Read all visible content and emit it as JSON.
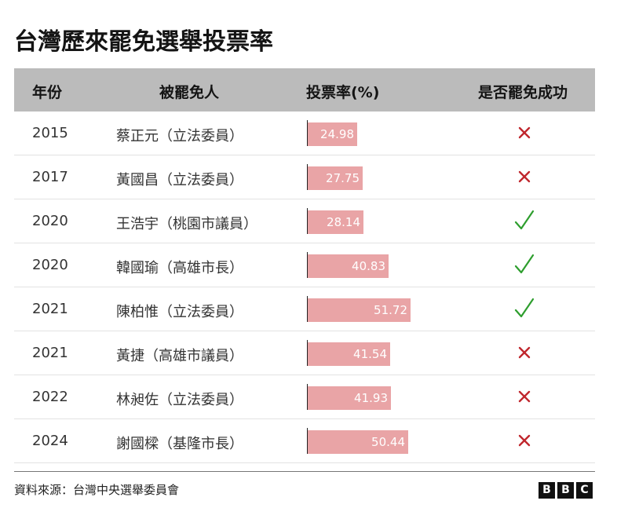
{
  "title": "台灣歷來罷免選舉投票率",
  "headers": {
    "year": "年份",
    "person": "被罷免人",
    "turnout": "投票率(%)",
    "result": "是否罷免成功"
  },
  "colors": {
    "bar": "#e9a4a6",
    "header_bg": "#bbbbbb",
    "cross": "#c0272d",
    "check": "#2e9e2e"
  },
  "chart_data": {
    "type": "bar",
    "title": "台灣歷來罷免選舉投票率",
    "xlabel": "",
    "ylabel": "投票率(%)",
    "ylim": [
      0,
      100
    ],
    "categories": [
      "2015",
      "2017",
      "2020",
      "2020",
      "2021",
      "2021",
      "2022",
      "2024"
    ],
    "rows": [
      {
        "year": "2015",
        "person": "蔡正元（立法委員）",
        "turnout": 24.98,
        "label": "24.98",
        "success": false
      },
      {
        "year": "2017",
        "person": "黃國昌（立法委員）",
        "turnout": 27.75,
        "label": "27.75",
        "success": false
      },
      {
        "year": "2020",
        "person": "王浩宇（桃園市議員）",
        "turnout": 28.14,
        "label": "28.14",
        "success": true
      },
      {
        "year": "2020",
        "person": "韓國瑜（高雄市長）",
        "turnout": 40.83,
        "label": "40.83",
        "success": true
      },
      {
        "year": "2021",
        "person": "陳柏惟（立法委員）",
        "turnout": 51.72,
        "label": "51.72",
        "success": true
      },
      {
        "year": "2021",
        "person": "黃捷（高雄市議員）",
        "turnout": 41.54,
        "label": "41.54",
        "success": false
      },
      {
        "year": "2022",
        "person": "林昶佐（立法委員）",
        "turnout": 41.93,
        "label": "41.93",
        "success": false
      },
      {
        "year": "2024",
        "person": "謝國樑（基隆市長）",
        "turnout": 50.44,
        "label": "50.44",
        "success": false
      }
    ]
  },
  "footer": {
    "source": "資料來源：台灣中央選舉委員會",
    "logo_letters": [
      "B",
      "B",
      "C"
    ]
  }
}
